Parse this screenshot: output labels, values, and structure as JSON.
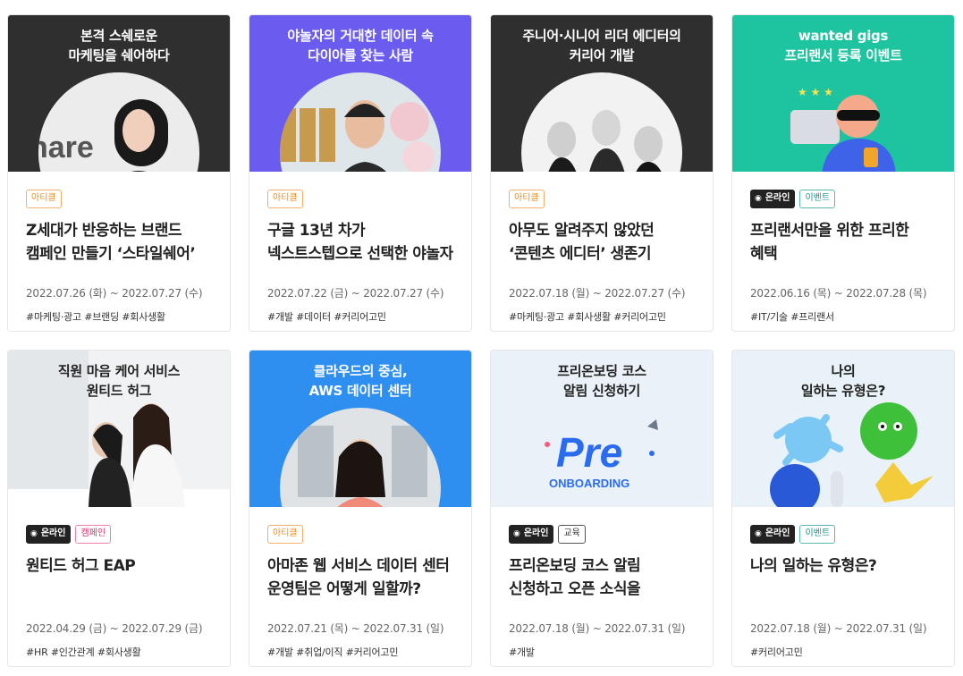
{
  "cards": [
    {
      "banner_line1": "본격 스쉐로운",
      "banner_line2": "마케팅을 쉐어하다",
      "photo_caption": "hare",
      "chips": [
        "아티클"
      ],
      "title": "Z세대가 반응하는 브랜드 캠페인 만들기 ‘스타일쉐어’",
      "date": "2022.07.26 (화) ~ 2022.07.27 (수)",
      "tags": "#마케팅·광고 #브랜딩 #회사생활"
    },
    {
      "banner_line1": "야놀자의 거대한 데이터 속",
      "banner_line2": "다이아를 찾는 사람",
      "chips": [
        "아티클"
      ],
      "title": "구글 13년 차가 넥스트스텝으로 선택한 야놀자",
      "date": "2022.07.22 (금) ~ 2022.07.27 (수)",
      "tags": "#개발 #데이터 #커리어고민"
    },
    {
      "banner_line1": "주니어·시니어 리더 에디터의",
      "banner_line2": "커리어 개발",
      "chips": [
        "아티클"
      ],
      "title": "아무도 알려주지 않았던 ‘콘텐츠 에디터’ 생존기",
      "date": "2022.07.18 (월) ~ 2022.07.27 (수)",
      "tags": "#마케팅·광고 #회사생활 #커리어고민"
    },
    {
      "banner_line1": "wanted gigs",
      "banner_line2": "프리랜서 등록 이벤트",
      "chips": [
        "온라인",
        "이벤트"
      ],
      "title": "프리랜서만을 위한 프리한 혜택",
      "date": "2022.06.16 (목) ~ 2022.07.28 (목)",
      "tags": "#IT/기술 #프리랜서"
    },
    {
      "banner_line1": "직원 마음 케어 서비스",
      "banner_line2": "원티드 허그",
      "chips": [
        "온라인",
        "캠페인"
      ],
      "title": "원티드 허그 EAP",
      "date": "2022.04.29 (금) ~ 2022.07.29 (금)",
      "tags": "#HR #인간관계 #회사생활"
    },
    {
      "banner_line1": "클라우드의 중심,",
      "banner_line2": "AWS 데이터 센터",
      "chips": [
        "아티클"
      ],
      "title": "아마존 웹 서비스 데이터 센터 운영팀은 어떻게 일할까?",
      "date": "2022.07.21 (목) ~ 2022.07.31 (일)",
      "tags": "#개발 #취업/이직 #커리어고민"
    },
    {
      "banner_line1": "프리온보딩 코스",
      "banner_line2": "알림 신청하기",
      "logo_text": "Pre",
      "logo_subtext": "ONBOARDING",
      "chips": [
        "온라인",
        "교육"
      ],
      "title": "프리온보딩 코스 알림 신청하고 오픈 소식을 받아보세요!",
      "date": "2022.07.18 (월) ~ 2022.07.31 (일)",
      "tags": "#개발"
    },
    {
      "banner_line1": "나의",
      "banner_line2": "일하는 유형은?",
      "chips": [
        "온라인",
        "이벤트"
      ],
      "title": "나의 일하는 유형은?",
      "date": "2022.07.18 (월) ~ 2022.07.31 (일)",
      "tags": "#커리어고민"
    }
  ],
  "colors": {
    "article": "#ed8f1d",
    "event": "#1c9a8c",
    "campaign": "#e0336e",
    "online": "#222222",
    "banner_dark": "#2f2f2f",
    "banner_purple": "#6b5cf0",
    "banner_green": "#1ec4a0",
    "banner_blue": "#2f8ff0",
    "banner_light": "#eaf1f9"
  },
  "icons": {
    "online_chip": "live-broadcast-icon"
  }
}
